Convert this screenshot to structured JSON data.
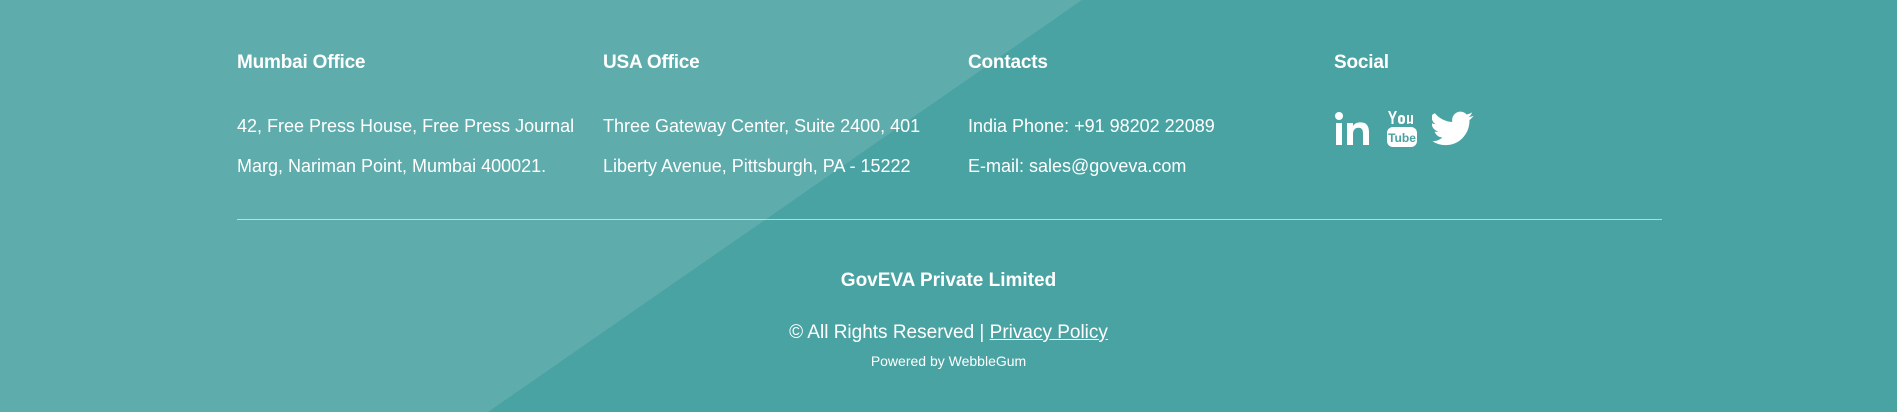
{
  "colors": {
    "background": "#4aa3a3",
    "highlight": "#5eacac",
    "text": "#ffffff"
  },
  "columns": [
    {
      "title": "Mumbai Office",
      "lines": [
        "42, Free Press House, Free Press Journal",
        "Marg, Nariman Point, Mumbai 400021."
      ]
    },
    {
      "title": "USA Office",
      "lines": [
        "Three Gateway Center, Suite 2400, 401",
        "Liberty Avenue, Pittsburgh, PA - 15222"
      ]
    },
    {
      "title": "Contacts",
      "lines": [
        "India Phone: +91 98202 22089",
        "E-mail: sales@goveva.com"
      ]
    },
    {
      "title": "Social",
      "icons": [
        "linkedin-icon",
        "youtube-icon",
        "twitter-icon"
      ]
    }
  ],
  "footer": {
    "company": "GovEVA Private Limited",
    "rights_text": "© All Rights Reserved | ",
    "privacy_link": "Privacy Policy",
    "powered_by": "Powered by WebbleGum"
  }
}
